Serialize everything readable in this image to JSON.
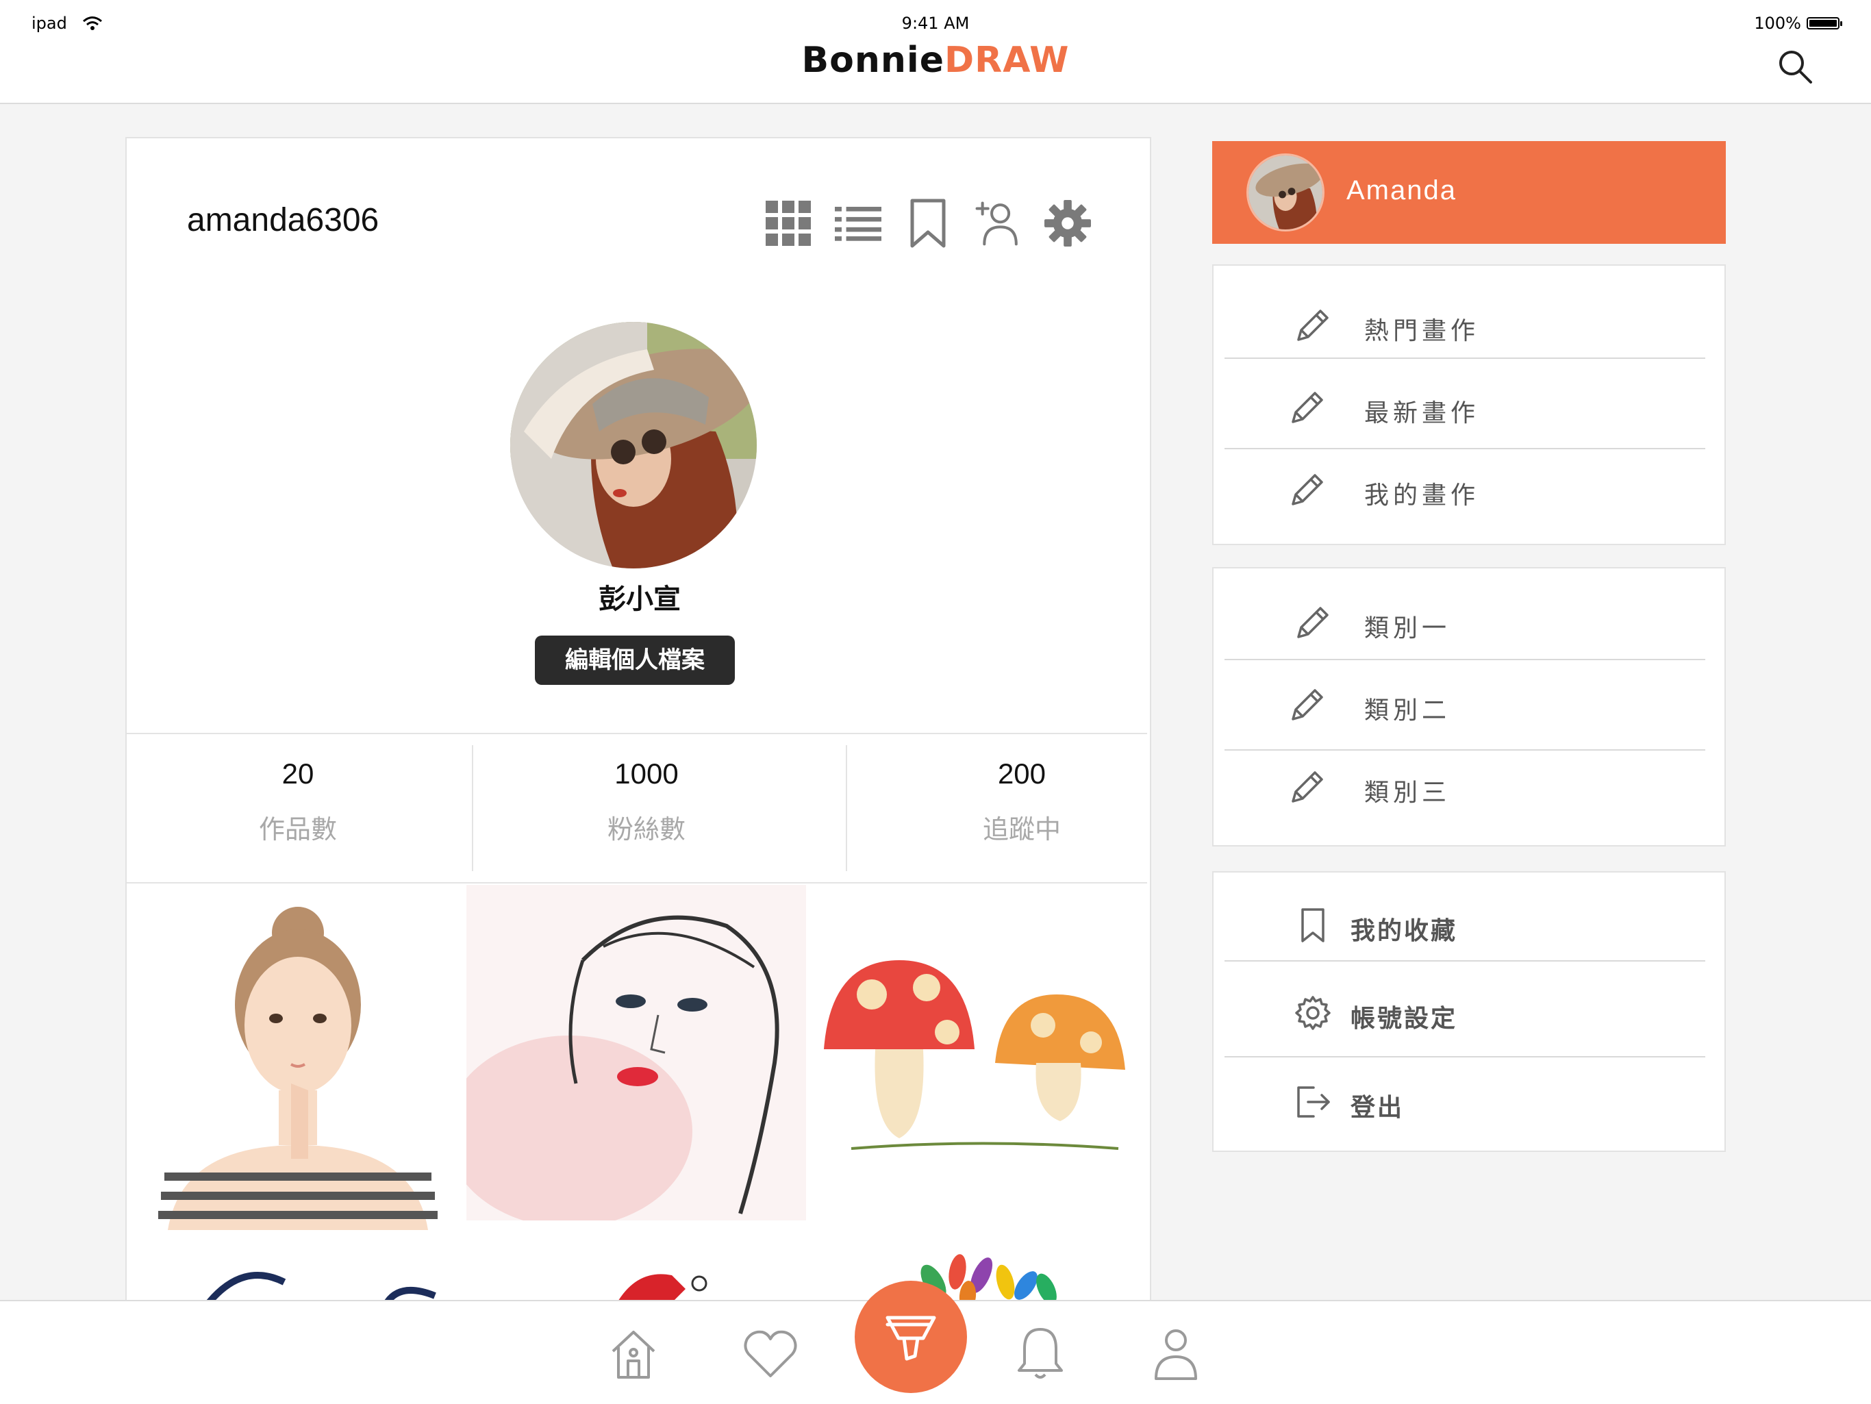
{
  "status_bar": {
    "carrier": "ipad",
    "time": "9:41 AM",
    "battery": "100%"
  },
  "brand": {
    "part1": "Bonnie",
    "part2": "DRAW"
  },
  "colors": {
    "accent": "#f07247",
    "dark": "#2b2b2b",
    "muted": "#a8a8a8"
  },
  "profile": {
    "username": "amanda6306",
    "display_name": "彭小宣",
    "edit_button": "編輯個人檔案",
    "toolbar_icons": [
      "grid-icon",
      "list-icon",
      "bookmark-icon",
      "add-user-icon",
      "gear-icon"
    ]
  },
  "stats": [
    {
      "value": "20",
      "label": "作品數"
    },
    {
      "value": "1000",
      "label": "粉絲數"
    },
    {
      "value": "200",
      "label": "追蹤中"
    }
  ],
  "side_menu": {
    "user_name": "Amanda",
    "group1": [
      "熱門畫作",
      "最新畫作",
      "我的畫作"
    ],
    "group2": [
      "類別一",
      "類別二",
      "類別三"
    ],
    "group3": [
      "我的收藏",
      "帳號設定",
      "登出"
    ]
  },
  "tabbar": {
    "icons": [
      "home-icon",
      "heart-icon",
      "brush-icon",
      "bell-icon",
      "profile-icon"
    ]
  }
}
